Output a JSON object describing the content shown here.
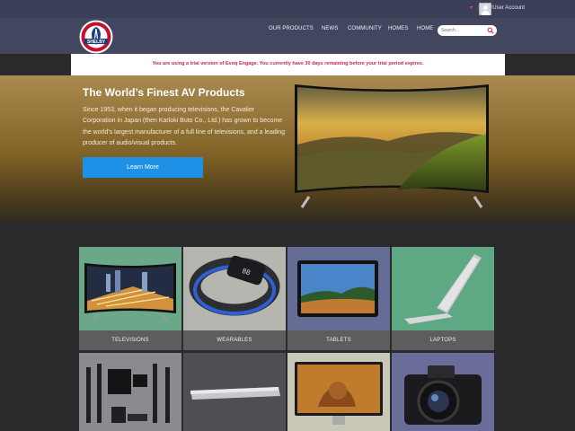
{
  "account": {
    "label": "SuperUser Account",
    "caret": "▾"
  },
  "logo": {
    "text": "SHELBY"
  },
  "nav": {
    "items": [
      "OUR PRODUCTS",
      "NEWS",
      "COMMUNITY",
      "HOMES",
      "HOME"
    ],
    "search_placeholder": "Search..."
  },
  "trial_notice": "You are using a trial version of Evoq Engage. You currently have 30 days remaining before your trial period expires.",
  "hero": {
    "title": "The World’s Finest AV Products",
    "body": "Since 1953, when it began producing televisions, the Cavalier Corporation in Japan (then Karloki Buto Co., Ltd.) has grown to become the world's largest manufacturer of a full line of televisions, and a leading producer of audio/visual products.",
    "button": "Learn More"
  },
  "categories": [
    {
      "label": "TELEVISIONS",
      "icon": "television-image"
    },
    {
      "label": "WEARABLES",
      "icon": "fitness-band-image"
    },
    {
      "label": "TABLETS",
      "icon": "tablet-image"
    },
    {
      "label": "LAPTOPS",
      "icon": "laptop-image"
    },
    {
      "label": "",
      "icon": "speaker-system-image"
    },
    {
      "label": "",
      "icon": "media-player-image"
    },
    {
      "label": "",
      "icon": "monitor-image"
    },
    {
      "label": "",
      "icon": "camera-image"
    }
  ],
  "colors": {
    "top_bar": "#3b3f58",
    "header": "#42465f",
    "accent_button": "#1e90e6",
    "trial_text": "#d4205a",
    "tile_label_bg": "#5d5d60"
  }
}
